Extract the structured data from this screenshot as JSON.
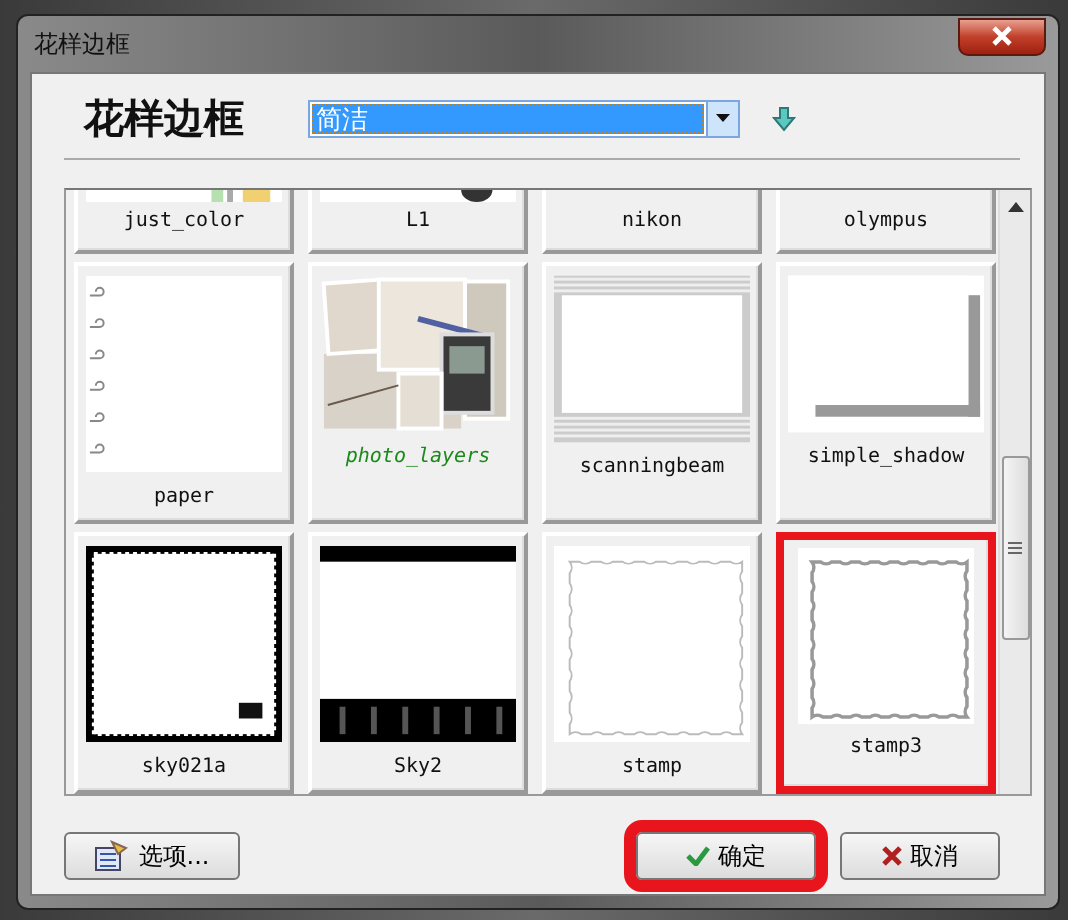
{
  "window": {
    "title": "花样边框"
  },
  "header": {
    "title": "花样边框",
    "category": {
      "value": "简洁"
    }
  },
  "tiles": [
    {
      "label": "just_color",
      "kind": "colors",
      "emphasized": false,
      "selected": false
    },
    {
      "label": "L1",
      "kind": "lens",
      "emphasized": false,
      "selected": false
    },
    {
      "label": "nikon",
      "kind": "blank",
      "emphasized": false,
      "selected": false
    },
    {
      "label": "olympus",
      "kind": "blank",
      "emphasized": false,
      "selected": false
    },
    {
      "label": "paper",
      "kind": "paper",
      "emphasized": false,
      "selected": false
    },
    {
      "label": "photo_layers",
      "emphasized": true,
      "selected": false
    },
    {
      "label": "scanningbeam",
      "kind": "beam",
      "emphasized": false,
      "selected": false
    },
    {
      "label": "simple_shadow",
      "kind": "shadow",
      "emphasized": false,
      "selected": false
    },
    {
      "label": "sky021a",
      "kind": "blackstamp",
      "emphasized": false,
      "selected": false
    },
    {
      "label": "Sky2",
      "kind": "sky",
      "emphasized": false,
      "selected": false
    },
    {
      "label": "stamp",
      "kind": "stamp",
      "emphasized": false,
      "selected": false
    },
    {
      "label": "stamp3",
      "kind": "stamp",
      "emphasized": false,
      "selected": true
    }
  ],
  "buttons": [
    {
      "label": "选项...",
      "kind": "options",
      "highlighted": false
    },
    {
      "label": "确定",
      "kind": "ok",
      "highlighted": true
    },
    {
      "label": "取消",
      "kind": "cancel",
      "highlighted": false
    }
  ]
}
